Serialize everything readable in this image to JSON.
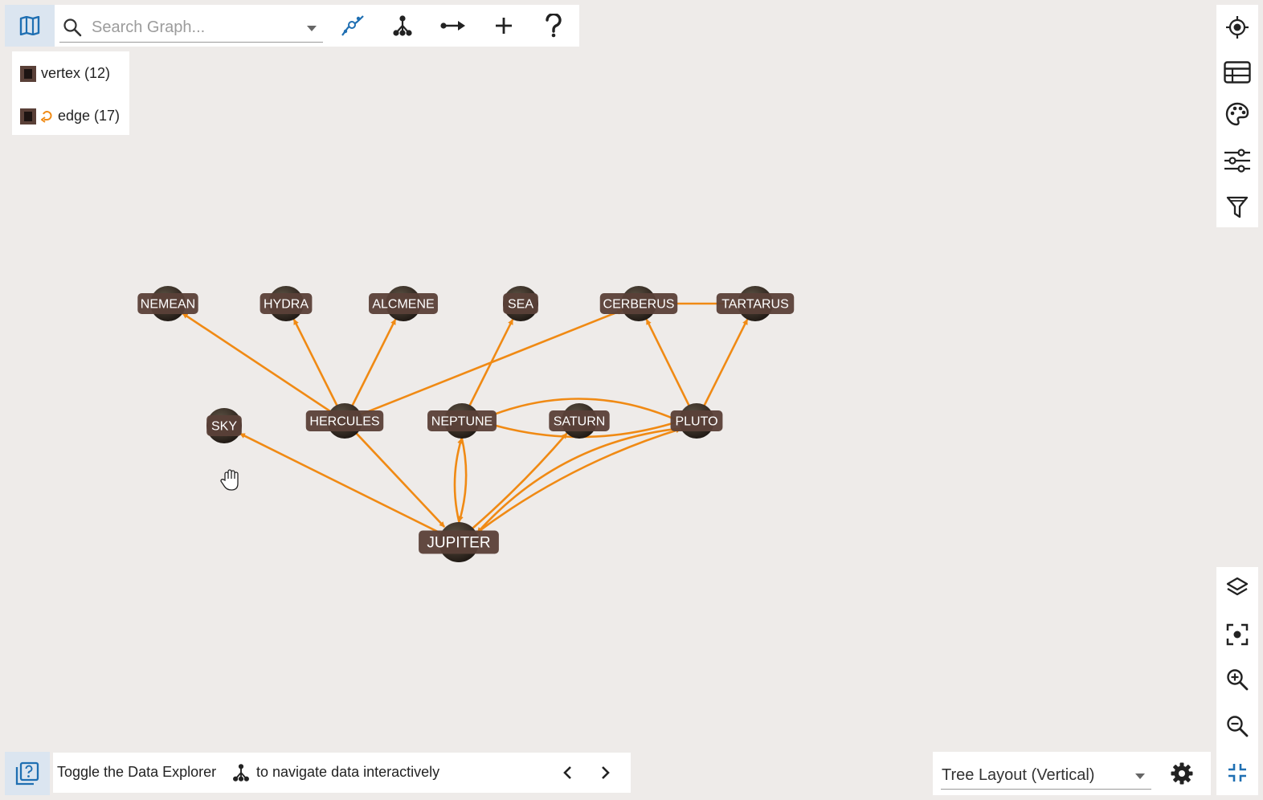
{
  "toolbar": {
    "search": {
      "placeholder": "Search Graph..."
    }
  },
  "legend": {
    "vertex_label": "vertex (12)",
    "edge_label": "edge (17)"
  },
  "graph": {
    "edge_color": "#f08a14",
    "node_label_color": "#5a4038",
    "nodes": [
      {
        "id": "nemean",
        "label": "NEMEAN"
      },
      {
        "id": "hydra",
        "label": "HYDRA"
      },
      {
        "id": "alcmene",
        "label": "ALCMENE"
      },
      {
        "id": "sea",
        "label": "SEA"
      },
      {
        "id": "cerberus",
        "label": "CERBERUS"
      },
      {
        "id": "tartarus",
        "label": "TARTARUS"
      },
      {
        "id": "sky",
        "label": "SKY"
      },
      {
        "id": "hercules",
        "label": "HERCULES"
      },
      {
        "id": "neptune",
        "label": "NEPTUNE"
      },
      {
        "id": "saturn",
        "label": "SATURN"
      },
      {
        "id": "pluto",
        "label": "PLUTO"
      },
      {
        "id": "jupiter",
        "label": "JUPITER"
      }
    ],
    "edges": [
      {
        "from": "hercules",
        "to": "nemean"
      },
      {
        "from": "hercules",
        "to": "hydra"
      },
      {
        "from": "hercules",
        "to": "alcmene"
      },
      {
        "from": "hercules",
        "to": "cerberus"
      },
      {
        "from": "hercules",
        "to": "jupiter"
      },
      {
        "from": "neptune",
        "to": "sea"
      },
      {
        "from": "neptune",
        "to": "jupiter"
      },
      {
        "from": "jupiter",
        "to": "neptune"
      },
      {
        "from": "neptune",
        "to": "pluto"
      },
      {
        "from": "pluto",
        "to": "neptune"
      },
      {
        "from": "pluto",
        "to": "cerberus"
      },
      {
        "from": "pluto",
        "to": "tartarus"
      },
      {
        "from": "pluto",
        "to": "jupiter"
      },
      {
        "from": "jupiter",
        "to": "pluto"
      },
      {
        "from": "jupiter",
        "to": "saturn"
      },
      {
        "from": "jupiter",
        "to": "sky"
      },
      {
        "from": "cerberus",
        "to": "tartarus"
      }
    ]
  },
  "hint": {
    "text_before": "Toggle the Data Explorer",
    "text_after": "to navigate data interactively"
  },
  "layout": {
    "selected": "Tree Layout (Vertical)"
  },
  "colors": {
    "background": "#eeebe9",
    "accent_blue": "#1f6fb2",
    "active_toggle_bg": "#dbe5f0"
  }
}
